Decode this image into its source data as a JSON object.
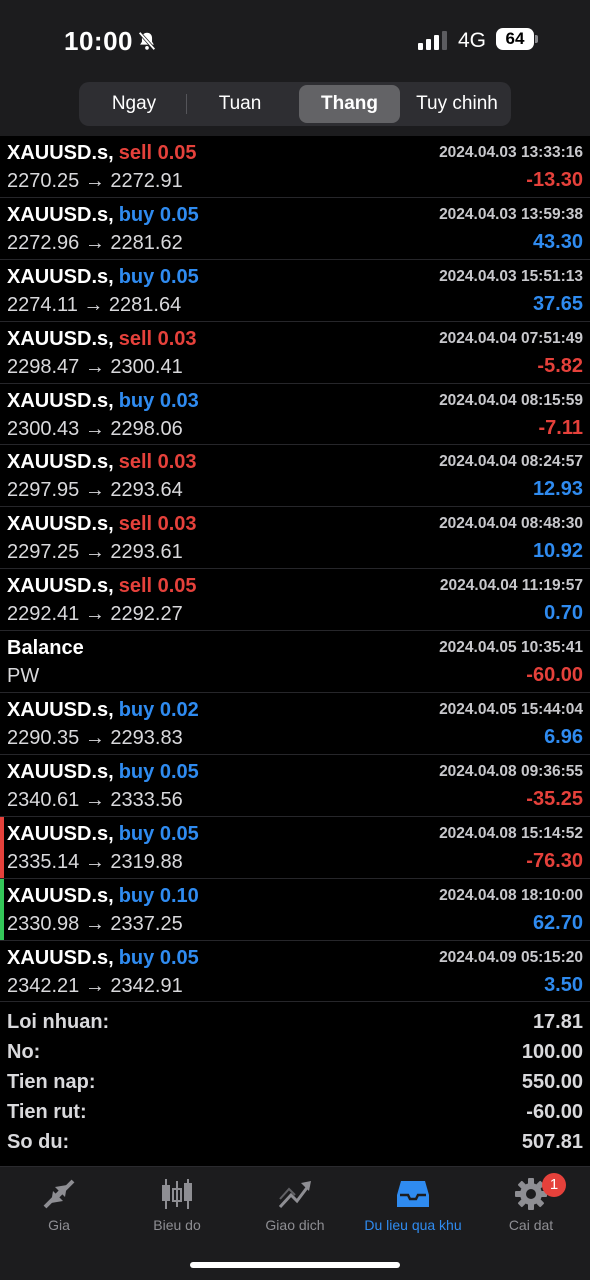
{
  "status_bar": {
    "time": "10:00",
    "network": "4G",
    "battery": "64"
  },
  "period_tabs": [
    {
      "label": "Ngay"
    },
    {
      "label": "Tuan"
    },
    {
      "label": "Thang",
      "active": true
    },
    {
      "label": "Tuy chinh"
    }
  ],
  "history": [
    {
      "symbol": "XAUUSD.s,",
      "side": "sell",
      "volume": "0.05",
      "prices": "2270.25 → 2272.91",
      "datetime": "2024.04.03 13:33:16",
      "profit": "-13.30"
    },
    {
      "symbol": "XAUUSD.s,",
      "side": "buy",
      "volume": "0.05",
      "prices": "2272.96 → 2281.62",
      "datetime": "2024.04.03 13:59:38",
      "profit": "43.30"
    },
    {
      "symbol": "XAUUSD.s,",
      "side": "buy",
      "volume": "0.05",
      "prices": "2274.11 → 2281.64",
      "datetime": "2024.04.03 15:51:13",
      "profit": "37.65"
    },
    {
      "symbol": "XAUUSD.s,",
      "side": "sell",
      "volume": "0.03",
      "prices": "2298.47 → 2300.41",
      "datetime": "2024.04.04 07:51:49",
      "profit": "-5.82"
    },
    {
      "symbol": "XAUUSD.s,",
      "side": "buy",
      "volume": "0.03",
      "prices": "2300.43 → 2298.06",
      "datetime": "2024.04.04 08:15:59",
      "profit": "-7.11"
    },
    {
      "symbol": "XAUUSD.s,",
      "side": "sell",
      "volume": "0.03",
      "prices": "2297.95 → 2293.64",
      "datetime": "2024.04.04 08:24:57",
      "profit": "12.93"
    },
    {
      "symbol": "XAUUSD.s,",
      "side": "sell",
      "volume": "0.03",
      "prices": "2297.25 → 2293.61",
      "datetime": "2024.04.04 08:48:30",
      "profit": "10.92"
    },
    {
      "symbol": "XAUUSD.s,",
      "side": "sell",
      "volume": "0.05",
      "prices": "2292.41 → 2292.27",
      "datetime": "2024.04.04 11:19:57",
      "profit": "0.70"
    },
    {
      "symbol": "Balance",
      "side": "",
      "volume": "",
      "prices": "PW",
      "datetime": "2024.04.05 10:35:41",
      "profit": "-60.00"
    },
    {
      "symbol": "XAUUSD.s,",
      "side": "buy",
      "volume": "0.02",
      "prices": "2290.35 → 2293.83",
      "datetime": "2024.04.05 15:44:04",
      "profit": "6.96"
    },
    {
      "symbol": "XAUUSD.s,",
      "side": "buy",
      "volume": "0.05",
      "prices": "2340.61 → 2333.56",
      "datetime": "2024.04.08 09:36:55",
      "profit": "-35.25"
    },
    {
      "symbol": "XAUUSD.s,",
      "side": "buy",
      "volume": "0.05",
      "prices": "2335.14 → 2319.88",
      "datetime": "2024.04.08 15:14:52",
      "profit": "-76.30",
      "marker": "#e5413b"
    },
    {
      "symbol": "XAUUSD.s,",
      "side": "buy",
      "volume": "0.10",
      "prices": "2330.98 → 2337.25",
      "datetime": "2024.04.08 18:10:00",
      "profit": "62.70",
      "marker": "#34c759"
    },
    {
      "symbol": "XAUUSD.s,",
      "side": "buy",
      "volume": "0.05",
      "prices": "2342.21 → 2342.91",
      "datetime": "2024.04.09 05:15:20",
      "profit": "3.50"
    }
  ],
  "summary": [
    {
      "label": "Loi nhuan:",
      "value": "17.81"
    },
    {
      "label": "No:",
      "value": "100.00"
    },
    {
      "label": "Tien nap:",
      "value": "550.00"
    },
    {
      "label": "Tien rut:",
      "value": "-60.00"
    },
    {
      "label": "So du:",
      "value": "507.81"
    }
  ],
  "tabbar": [
    {
      "label": "Gia",
      "icon": "quotes-arrows-icon"
    },
    {
      "label": "Bieu do",
      "icon": "candlestick-chart-icon"
    },
    {
      "label": "Giao dich",
      "icon": "trade-trend-icon"
    },
    {
      "label": "Du lieu qua khu",
      "icon": "history-inbox-icon",
      "active": true
    },
    {
      "label": "Cai dat",
      "icon": "settings-gear-icon",
      "badge": "1"
    }
  ],
  "colors": {
    "sell": "#e5413b",
    "buy": "#2f8bf0",
    "negative": "#e5413b",
    "positive": "#2f8bf0",
    "accent": "#2f8bf0"
  }
}
